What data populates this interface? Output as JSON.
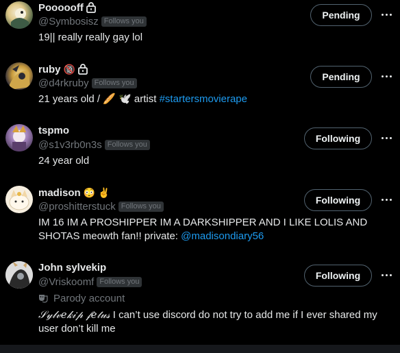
{
  "users": [
    {
      "name": "Poooooff",
      "handle": "@Symbosisz",
      "follows_you": "Follows you",
      "bio": "19|| really really gay lol",
      "button": "Pending"
    },
    {
      "name": "ruby",
      "name_emoji": "🔞",
      "handle": "@d4rkruby",
      "follows_you": "Follows you",
      "bio_text": "21 years old / 🥖 🕊️ artist ",
      "bio_link": "#startersmovierape",
      "button": "Pending"
    },
    {
      "name": "tspmo",
      "handle": "@s1v3rb0n3s",
      "follows_you": "Follows you",
      "bio": "24 year old",
      "button": "Following"
    },
    {
      "name": "madison",
      "name_emoji": "😳 ✌️",
      "handle": "@proshitterstuck",
      "follows_you": "Follows you",
      "bio_text": "IM 16 IM A PROSHIPPER IM A DARKSHIPPER AND I LIKE LOLIS AND SHOTAS meowth fan!! private: ",
      "bio_link": "@madisondiary56",
      "button": "Following"
    },
    {
      "name": "John sylvekip",
      "handle": "@Vriskoomf",
      "follows_you": "Follows you",
      "parody_label": "Parody account",
      "bio_fancy": "𝒮𝓎𝓁𝓋𝑒𝓀𝒾𝓅 𝒻𝑒𝓉𝓊𝓈",
      "bio_text": " I can’t use discord do not try to add me if I ever shared my user don’t kill me",
      "button": "Following"
    }
  ],
  "colors": {
    "background": "#000000",
    "text": "#e7e9ea",
    "muted": "#71767b",
    "link": "#1d9bf0",
    "badge_bg": "#2f3336"
  }
}
